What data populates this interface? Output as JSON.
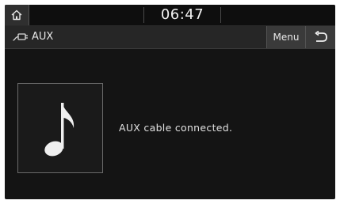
{
  "status_bar": {
    "time": "06:47",
    "home_icon": "home-icon"
  },
  "title_bar": {
    "source_icon": "aux-cable-icon",
    "title": "AUX",
    "menu_label": "Menu",
    "back_icon": "back-arrow-icon"
  },
  "main": {
    "album_art_icon": "music-note-icon",
    "message": "AUX cable connected."
  },
  "colors": {
    "screen_bg": "#141414",
    "title_bar_bg": "#262626",
    "button_bg": "#3a3a3a",
    "text": "#e6e6e6"
  }
}
